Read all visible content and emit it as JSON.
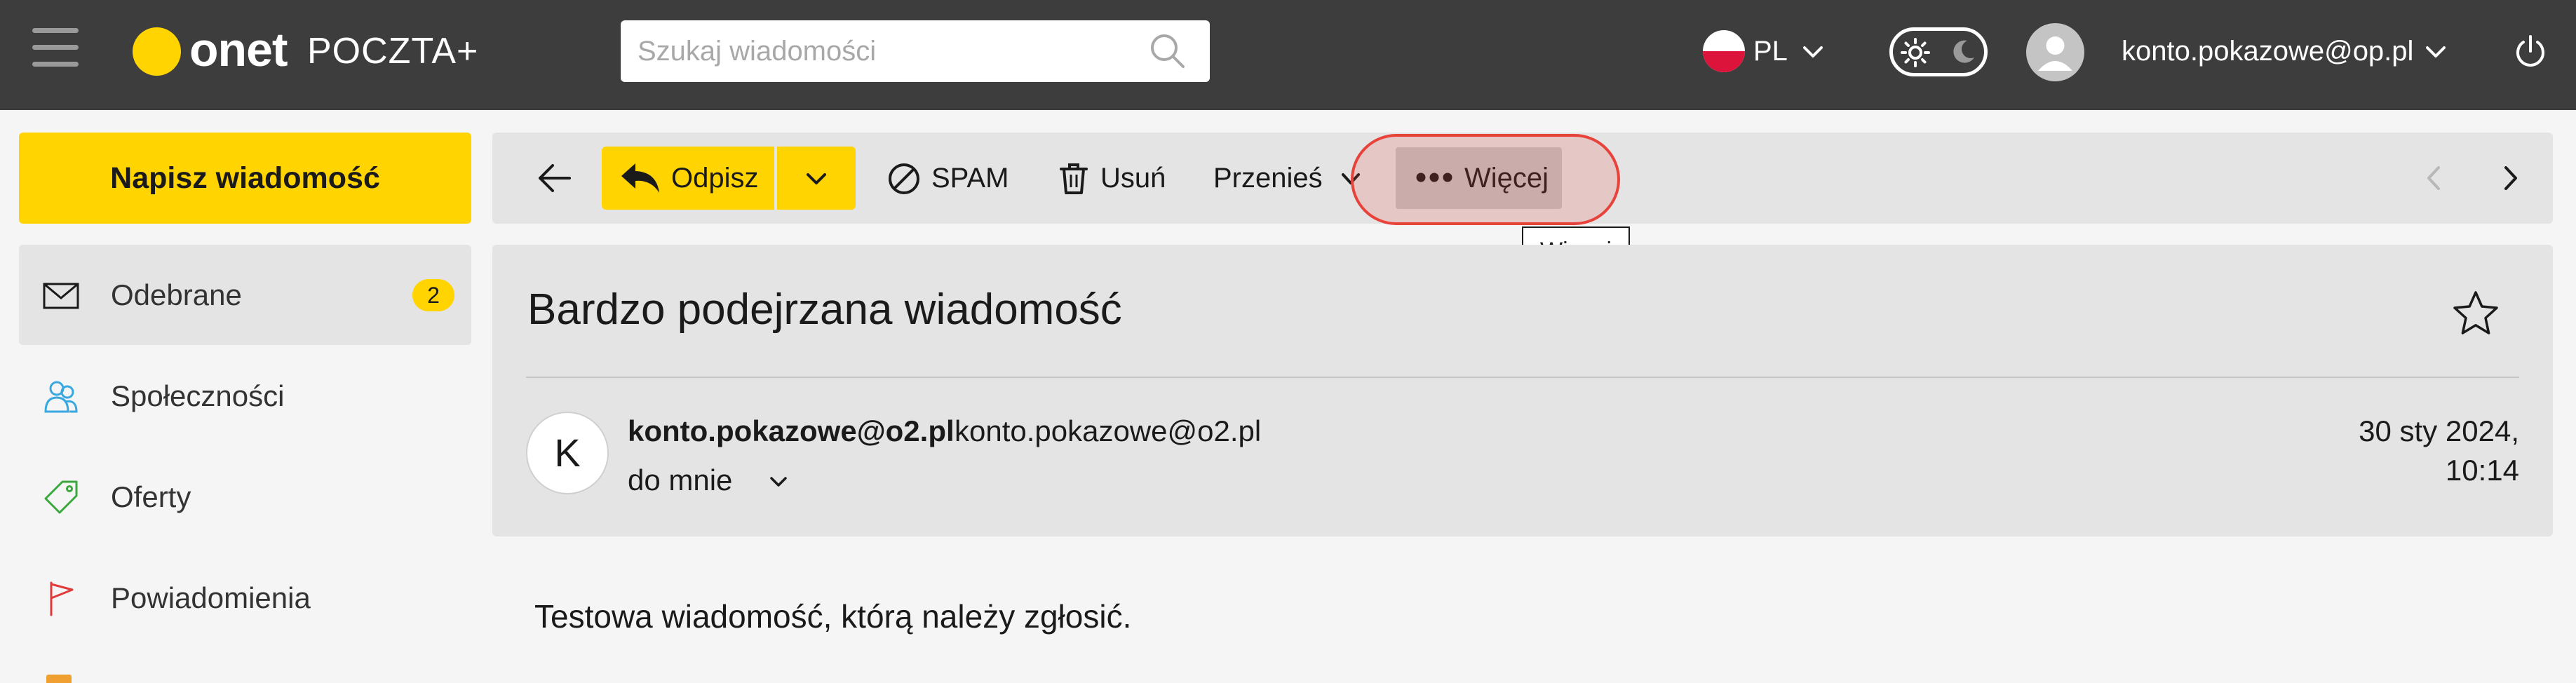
{
  "header": {
    "logo_brand": "onet",
    "logo_product": "POCZTA+",
    "search_placeholder": "Szukaj wiadomości",
    "language": "PL",
    "account_email": "konto.pokazowe@op.pl"
  },
  "sidebar": {
    "compose_label": "Napisz wiadomość",
    "items": [
      {
        "label": "Odebrane",
        "badge": "2",
        "icon": "envelope-icon",
        "active": true
      },
      {
        "label": "Społeczności",
        "icon": "people-icon"
      },
      {
        "label": "Oferty",
        "icon": "tag-icon"
      },
      {
        "label": "Powiadomienia",
        "icon": "flag-icon"
      }
    ]
  },
  "toolbar": {
    "reply_label": "Odpisz",
    "spam_label": "SPAM",
    "delete_label": "Usuń",
    "move_label": "Przenieś",
    "more_label": "Więcej",
    "tooltip": "Więcej"
  },
  "message": {
    "subject": "Bardzo podejrzana wiadomość",
    "avatar_letter": "K",
    "sender_name": "konto.pokazowe@o2.pl",
    "sender_email": "konto.pokazowe@o2.pl",
    "date": "30 sty 2024, 10:14",
    "recipient": "do mnie",
    "body": "Testowa wiadomość, którą należy zgłosić."
  },
  "colors": {
    "accent": "#ffd400",
    "topbar": "#3d3d3d",
    "highlight": "#e8433a",
    "panel": "#e4e4e4"
  }
}
